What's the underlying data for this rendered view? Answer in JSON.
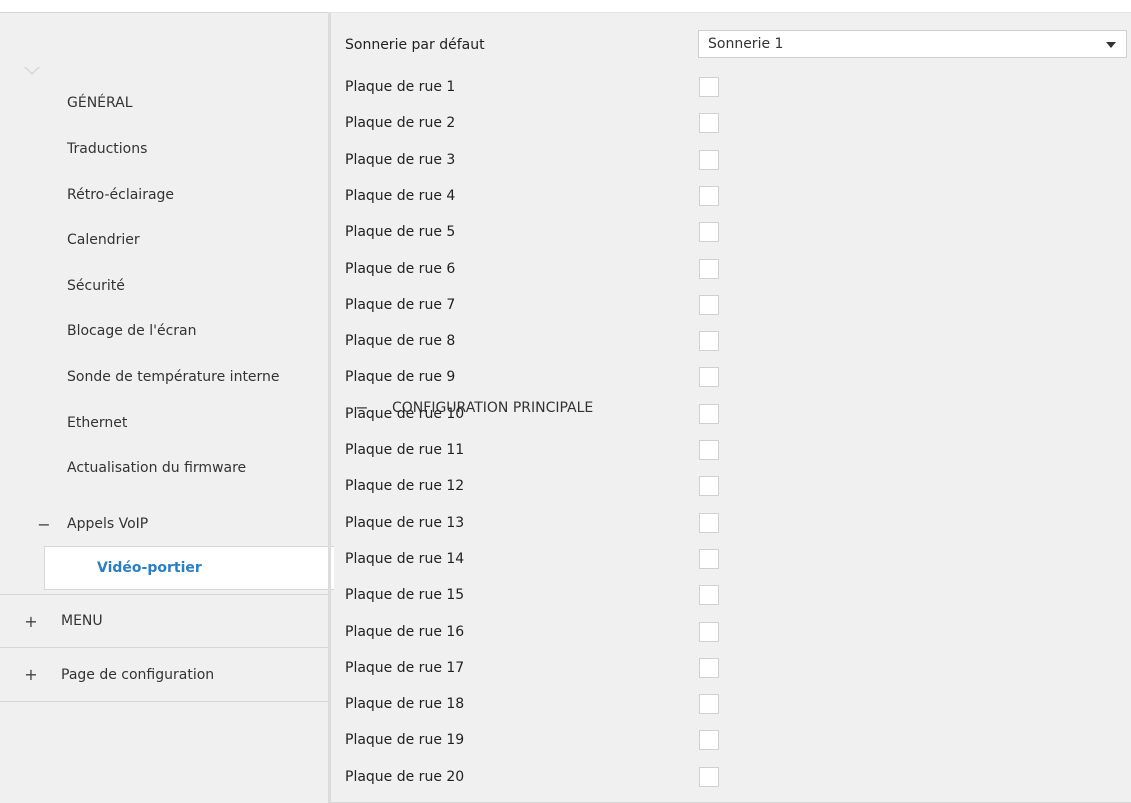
{
  "sidebar": {
    "main_section": {
      "sign": "−",
      "label": "CONFIGURATION PRINCIPALE"
    },
    "items": [
      {
        "label": "GÉNÉRAL"
      },
      {
        "label": "Traductions"
      },
      {
        "label": "Rétro-éclairage"
      },
      {
        "label": "Calendrier"
      },
      {
        "label": "Sécurité"
      },
      {
        "label": "Blocage de l'écran"
      },
      {
        "label": "Sonde de température interne"
      },
      {
        "label": "Ethernet"
      },
      {
        "label": "Actualisation du firmware"
      }
    ],
    "voip": {
      "sign": "−",
      "label": "Appels VoIP"
    },
    "selected": {
      "label": "Vidéo-portier"
    },
    "menu_section": {
      "sign": "+",
      "label": "MENU"
    },
    "page_config_section": {
      "sign": "+",
      "label": "Page de configuration"
    }
  },
  "main": {
    "ringtone": {
      "label": "Sonnerie par défaut",
      "value": "Sonnerie 1"
    },
    "plates": [
      {
        "label": "Plaque de rue 1",
        "checked": false
      },
      {
        "label": "Plaque de rue 2",
        "checked": false
      },
      {
        "label": "Plaque de rue 3",
        "checked": false
      },
      {
        "label": "Plaque de rue 4",
        "checked": false
      },
      {
        "label": "Plaque de rue 5",
        "checked": false
      },
      {
        "label": "Plaque de rue 6",
        "checked": false
      },
      {
        "label": "Plaque de rue 7",
        "checked": false
      },
      {
        "label": "Plaque de rue 8",
        "checked": false
      },
      {
        "label": "Plaque de rue 9",
        "checked": false
      },
      {
        "label": "Plaque de rue 10",
        "checked": false
      },
      {
        "label": "Plaque de rue 11",
        "checked": false
      },
      {
        "label": "Plaque de rue 12",
        "checked": false
      },
      {
        "label": "Plaque de rue 13",
        "checked": false
      },
      {
        "label": "Plaque de rue 14",
        "checked": false
      },
      {
        "label": "Plaque de rue 15",
        "checked": false
      },
      {
        "label": "Plaque de rue 16",
        "checked": false
      },
      {
        "label": "Plaque de rue 17",
        "checked": false
      },
      {
        "label": "Plaque de rue 18",
        "checked": false
      },
      {
        "label": "Plaque de rue 19",
        "checked": false
      },
      {
        "label": "Plaque de rue 20",
        "checked": false
      }
    ]
  },
  "colors": {
    "accent": "#2a7ec4",
    "sidebar_bg": "#f0f0f0",
    "border": "#d6d6d6"
  }
}
